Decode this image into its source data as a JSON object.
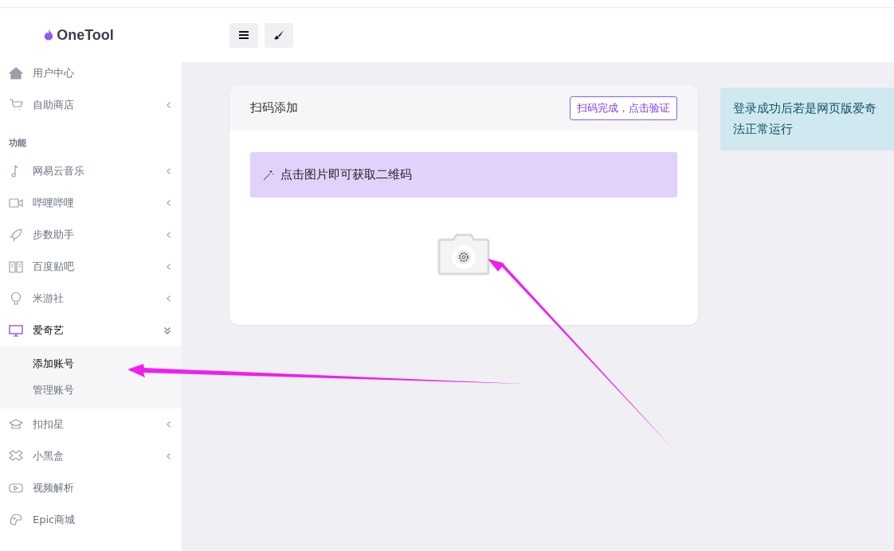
{
  "logo": {
    "text": "OneTool"
  },
  "sidebar": {
    "items": [
      {
        "kind": "item",
        "label": "用户中心",
        "expandable": false,
        "expanded": false
      },
      {
        "kind": "item",
        "label": "自助商店",
        "expandable": true,
        "expanded": false
      },
      {
        "kind": "section",
        "label": "功能"
      },
      {
        "kind": "item",
        "label": "网易云音乐",
        "expandable": true,
        "expanded": false
      },
      {
        "kind": "item",
        "label": "哔哩哔哩",
        "expandable": true,
        "expanded": false
      },
      {
        "kind": "item",
        "label": "步数助手",
        "expandable": true,
        "expanded": false
      },
      {
        "kind": "item",
        "label": "百度贴吧",
        "expandable": true,
        "expanded": false
      },
      {
        "kind": "item",
        "label": "米游社",
        "expandable": true,
        "expanded": false
      },
      {
        "kind": "item",
        "label": "爱奇艺",
        "expandable": true,
        "expanded": true,
        "children": [
          {
            "label": "添加账号",
            "selected": true
          },
          {
            "label": "管理账号",
            "selected": false
          }
        ]
      },
      {
        "kind": "item",
        "label": "扣扣星",
        "expandable": true,
        "expanded": false
      },
      {
        "kind": "item",
        "label": "小黑盒",
        "expandable": true,
        "expanded": false
      },
      {
        "kind": "item",
        "label": "视频解析",
        "expandable": false,
        "expanded": false
      },
      {
        "kind": "item",
        "label": "Epic商城",
        "expandable": false,
        "expanded": false
      }
    ]
  },
  "card": {
    "title": "扫码添加",
    "button": "扫码完成，点击验证",
    "alert": "点击图片即可获取二维码"
  },
  "info": {
    "lines": [
      "登录成功后若是网页版爱奇",
      "法正常运行"
    ]
  }
}
